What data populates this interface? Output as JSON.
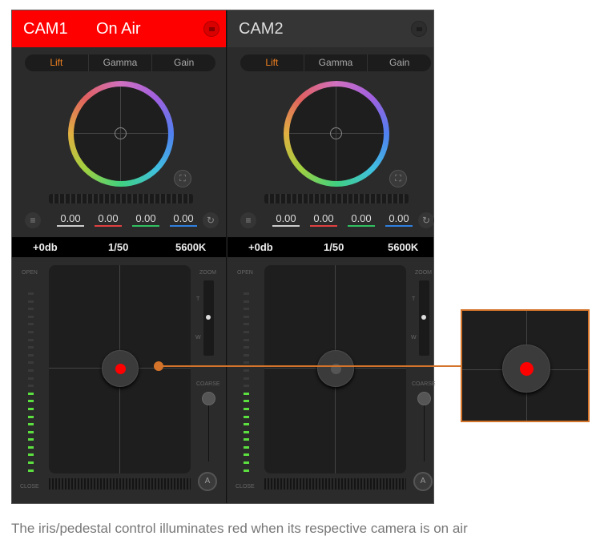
{
  "cameras": [
    {
      "name": "CAM1",
      "on_air": "On Air",
      "tabs": [
        "Lift",
        "Gamma",
        "Gain"
      ],
      "values": [
        "0.00",
        "0.00",
        "0.00",
        "0.00"
      ],
      "gain": "+0db",
      "shutter": "1/50",
      "white_balance": "5600K",
      "iris_open_label": "OPEN",
      "iris_close_label": "CLOSE",
      "zoom_label": "ZOOM",
      "zoom_t": "T",
      "zoom_w": "W",
      "coarse_label": "COARSE",
      "auto_label": "A",
      "iris_level": 0.45
    },
    {
      "name": "CAM2",
      "on_air": "",
      "tabs": [
        "Lift",
        "Gamma",
        "Gain"
      ],
      "values": [
        "0.00",
        "0.00",
        "0.00",
        "0.00"
      ],
      "gain": "+0db",
      "shutter": "1/50",
      "white_balance": "5600K",
      "iris_open_label": "OPEN",
      "iris_close_label": "CLOSE",
      "zoom_label": "ZOOM",
      "zoom_t": "T",
      "zoom_w": "W",
      "coarse_label": "COARSE",
      "auto_label": "A",
      "iris_level": 0.45
    }
  ],
  "value_colors": [
    "#cccccc",
    "#e04040",
    "#30c060",
    "#3080e0"
  ],
  "on_air_color": "#ff0000",
  "caption": "The iris/pedestal control illuminates red when its respective camera is on air"
}
